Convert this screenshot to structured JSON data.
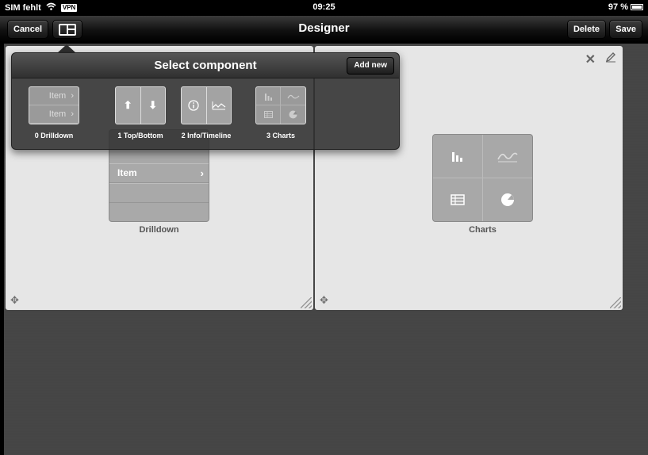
{
  "statusbar": {
    "carrier": "SIM fehlt",
    "vpn": "VPN",
    "time": "09:25",
    "battery": "97 %"
  },
  "navbar": {
    "title": "Designer",
    "cancel_label": "Cancel",
    "delete_label": "Delete",
    "save_label": "Save",
    "layout_icon": "layout-icon"
  },
  "panels": {
    "left": {
      "caption": "Drilldown",
      "row_label": "Item"
    },
    "right": {
      "caption": "Charts"
    }
  },
  "popover": {
    "title": "Select component",
    "add_new_label": "Add new",
    "components": [
      {
        "label": "0 Drilldown",
        "rows": [
          "Item",
          "Item"
        ]
      },
      {
        "label": "1 Top/Bottom",
        "icons": [
          "arrow-up-icon",
          "arrow-down-icon"
        ]
      },
      {
        "label": "2 Info/Timeline",
        "icons": [
          "info-icon",
          "line-chart-icon"
        ]
      },
      {
        "label": "3 Charts",
        "icons": [
          "bar-chart-icon",
          "line-chart-icon",
          "table-icon",
          "pie-chart-icon"
        ]
      }
    ]
  },
  "colors": {
    "panel_bg": "#e6e6e6",
    "background": "#444444",
    "navbar": "#111111"
  }
}
